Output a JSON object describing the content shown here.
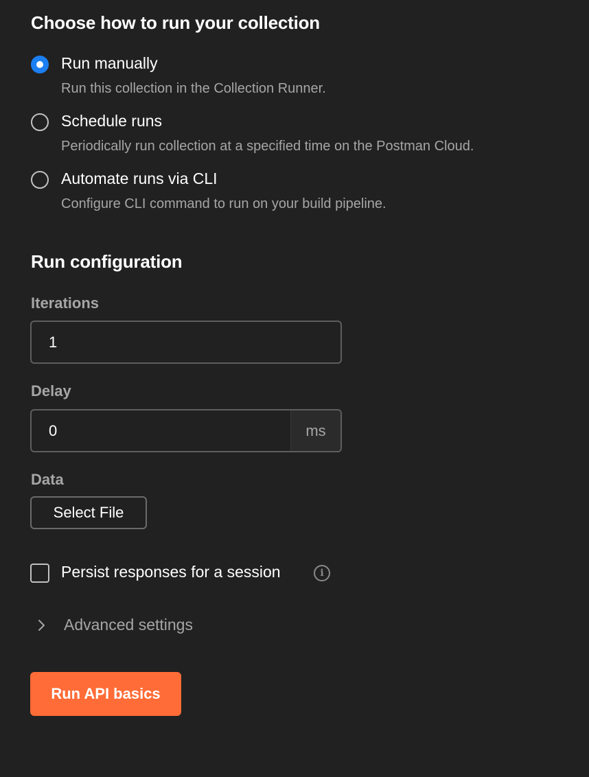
{
  "run_mode": {
    "title": "Choose how to run your collection",
    "options": [
      {
        "label": "Run manually",
        "description": "Run this collection in the Collection Runner.",
        "selected": true
      },
      {
        "label": "Schedule runs",
        "description": "Periodically run collection at a specified time on the Postman Cloud.",
        "selected": false
      },
      {
        "label": "Automate runs via CLI",
        "description": "Configure CLI command to run on your build pipeline.",
        "selected": false
      }
    ]
  },
  "run_config": {
    "title": "Run configuration",
    "iterations": {
      "label": "Iterations",
      "value": "1"
    },
    "delay": {
      "label": "Delay",
      "value": "0",
      "unit": "ms"
    },
    "data": {
      "label": "Data",
      "button_label": "Select File"
    },
    "persist": {
      "label": "Persist responses for a session",
      "checked": false
    },
    "advanced": {
      "label": "Advanced settings",
      "expanded": false
    }
  },
  "actions": {
    "run_label": "Run API basics"
  },
  "colors": {
    "background": "#212121",
    "accent_radio": "#1b7ff2",
    "primary_button": "#ff6c37",
    "muted_text": "#a6a6a6"
  },
  "icons": {
    "info": "info-icon",
    "chevron": "chevron-right-icon"
  }
}
